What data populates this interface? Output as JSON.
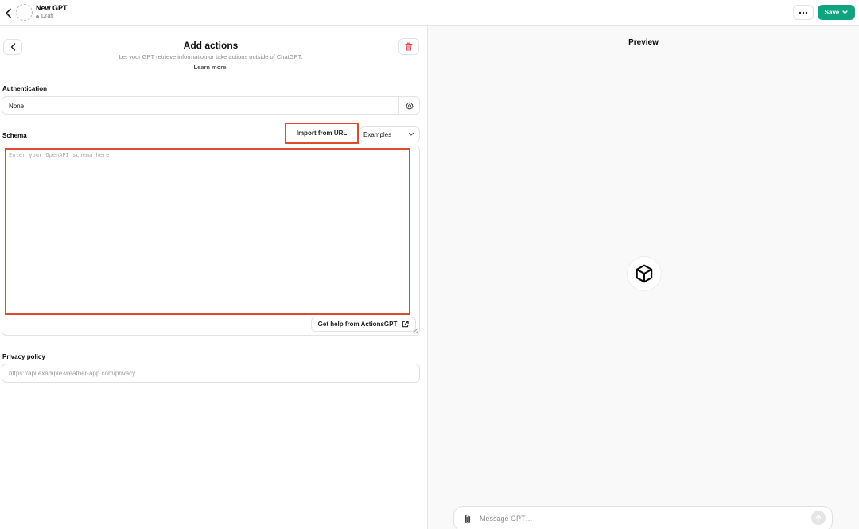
{
  "header": {
    "gpt_name": "New GPT",
    "gpt_status": "Draft",
    "save_label": "Save"
  },
  "editor": {
    "title": "Add actions",
    "subtitle": "Let your GPT retrieve information or take actions outside of ChatGPT.",
    "learn_more": "Learn more.",
    "authentication": {
      "label": "Authentication",
      "value": "None"
    },
    "schema": {
      "label": "Schema",
      "import_label": "Import from URL",
      "examples_label": "Examples",
      "placeholder": "Enter your OpenAPI schema here",
      "value": "",
      "help_label": "Get help from ActionsGPT"
    },
    "privacy": {
      "label": "Privacy policy",
      "placeholder": "https://api.example-weather-app.com/privacy",
      "value": ""
    }
  },
  "preview": {
    "title": "Preview",
    "message_placeholder": "Message GPT…"
  },
  "icons": {
    "back": "chevron-left-icon",
    "more": "ellipsis-icon",
    "save_dropdown": "chevron-down-icon",
    "delete": "trash-icon",
    "auth_settings": "gear-icon",
    "examples_dropdown": "chevron-down-icon",
    "external_link": "external-link-icon",
    "gpt_avatar": "cube-icon",
    "attach": "paperclip-icon",
    "send": "arrow-up-icon"
  },
  "colors": {
    "accent_green": "#10a37f",
    "highlight_red": "#e24a2e",
    "delete_red": "#e5484d",
    "border": "#e3e3e3",
    "preview_bg": "#f9f9f9"
  }
}
